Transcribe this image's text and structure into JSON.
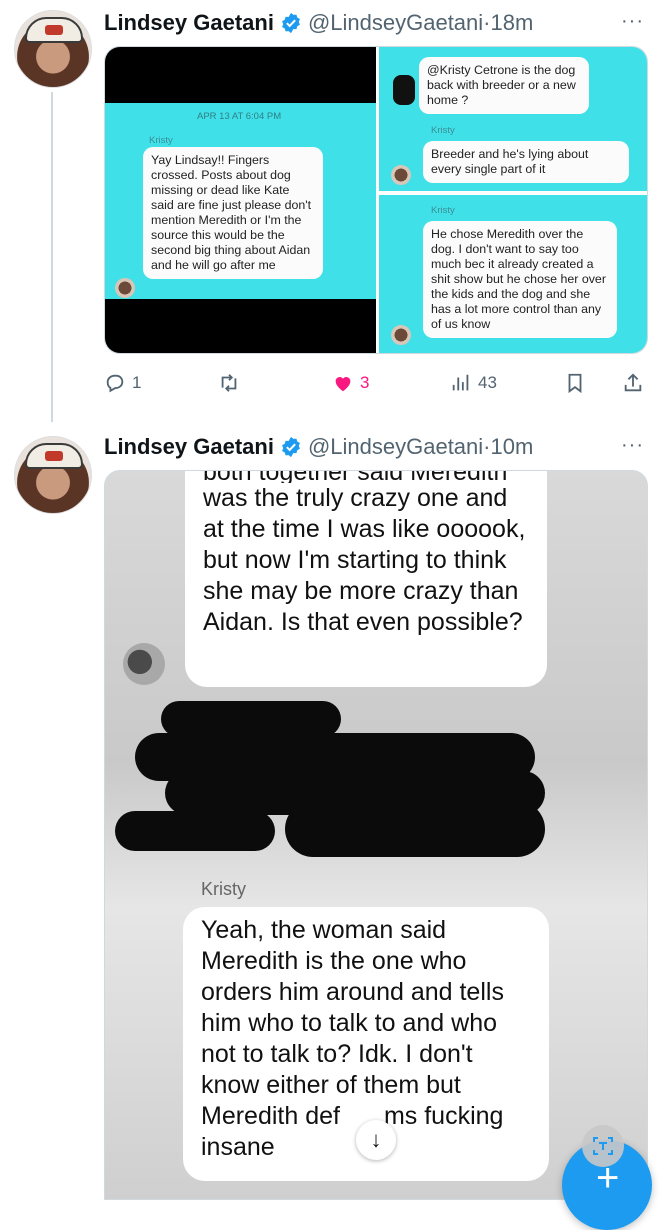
{
  "tweets": [
    {
      "author_name": "Lindsey Gaetani",
      "handle": "@LindseyGaetani",
      "separator": "·",
      "time": "18m",
      "more": "···",
      "media": {
        "left": {
          "timestamp": "APR 13 AT 6:04 PM",
          "sender": "Kristy",
          "message": "Yay Lindsay!! Fingers crossed. Posts about dog missing or dead like Kate said are fine just please don't mention Meredith or I'm the source this would be the second big thing about Aidan and he will go after me"
        },
        "top_right": {
          "question": "@Kristy Cetrone is the dog back with breeder or a new home ?",
          "sender": "Kristy",
          "reply": "Breeder and he's lying about every single part of it"
        },
        "bottom_right": {
          "sender": "Kristy",
          "message": "He chose Meredith over the dog. I don't want to say too much bec it already created a shit show but he chose her over the kids and the dog and she has a lot more control than any of us know"
        }
      },
      "actions": {
        "replies": "1",
        "retweets": "",
        "likes": "3",
        "views": "43"
      }
    },
    {
      "author_name": "Lindsey Gaetani",
      "handle": "@LindseyGaetani",
      "separator": "·",
      "time": "10m",
      "more": "···",
      "media": {
        "first_bubble_cut": "both together said Meredith",
        "first_bubble": "was the truly crazy one and at the time I was like oooook, but now I'm starting to think she may be more crazy than Aidan. Is that even possible?",
        "sender": "Kristy",
        "second_bubble": "Yeah, the woman said Meredith is the one who orders him around and tells him who to talk to and who not to talk to? Idk. I don't know either of them but Meredith def",
        "second_bubble_end": "ms fucking insane"
      }
    }
  ],
  "colors": {
    "accent": "#1d9bf0",
    "like": "#f91880",
    "muted": "#536471",
    "teal": "#40e0e8"
  },
  "icons": [
    "verified-badge-icon",
    "reply-icon",
    "retweet-icon",
    "heart-icon",
    "views-icon",
    "bookmark-icon",
    "share-icon",
    "chevron-down-icon",
    "scan-text-icon",
    "plus-icon"
  ]
}
